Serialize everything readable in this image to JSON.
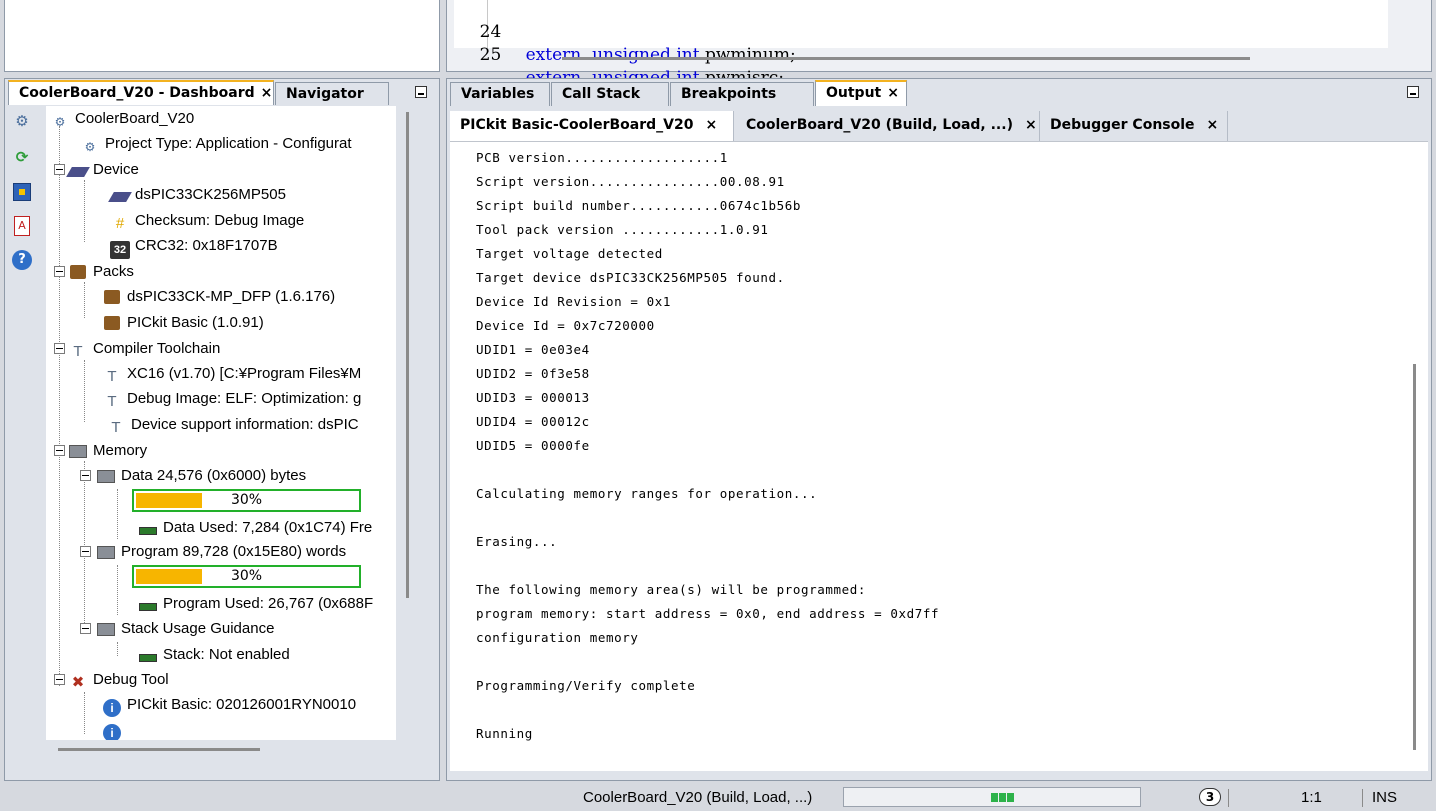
{
  "editor": {
    "lines": [
      {
        "num": "24",
        "kw1": "extern",
        "kw2": "unsigned",
        "kw3": "int",
        "ident": "pwminum;"
      },
      {
        "num": "25",
        "kw1": "extern",
        "kw2": "unsigned",
        "kw3": "int",
        "ident": "pwmisrc;"
      }
    ]
  },
  "dashboard": {
    "tabs": [
      {
        "label": "CoolerBoard_V20 - Dashboard",
        "close": "×"
      },
      {
        "label": "Navigator"
      }
    ],
    "toolbar_icons": [
      "settings-icon",
      "refresh-icon",
      "chip-icon",
      "pdf-icon",
      "help-icon"
    ],
    "tree": {
      "root": "CoolerBoard_V20",
      "project_type": "Project Type: Application - Configurat",
      "device": "Device",
      "device_name": "dsPIC33CK256MP505",
      "checksum": "Checksum: Debug Image",
      "crc": "CRC32: 0x18F1707B",
      "crc_badge": "32",
      "packs": "Packs",
      "pack1": "dsPIC33CK-MP_DFP (1.6.176)",
      "pack2": "PICkit Basic (1.0.91)",
      "compiler": "Compiler Toolchain",
      "xc16": "XC16 (v1.70) [C:¥Program Files¥M",
      "debug_image": "Debug Image: ELF: Optimization: g",
      "device_support": "Device support information: dsPIC",
      "memory": "Memory",
      "data": "Data 24,576 (0x6000) bytes",
      "data_pct_label": "30%",
      "data_pct": 0.3,
      "data_used": "Data Used: 7,284 (0x1C74) Fre",
      "program": "Program 89,728 (0x15E80) words",
      "program_pct_label": "30%",
      "program_pct": 0.3,
      "program_used": "Program Used: 26,767 (0x688F",
      "stack": "Stack Usage Guidance",
      "stack_status": "Stack: Not enabled",
      "debug_tool": "Debug Tool",
      "pickit": "PICkit Basic: 020126001RYN0010"
    }
  },
  "output": {
    "tabs": [
      {
        "label": "Variables"
      },
      {
        "label": "Call Stack"
      },
      {
        "label": "Breakpoints"
      },
      {
        "label": "Output",
        "close": "×"
      }
    ],
    "sub_tabs": [
      {
        "label": "PICkit Basic-CoolerBoard_V20",
        "close": "×"
      },
      {
        "label": "CoolerBoard_V20 (Build, Load, ...)",
        "close": "×"
      },
      {
        "label": "Debugger Console",
        "close": "×"
      }
    ],
    "console_lines": [
      "PCB version...................1",
      "Script version................00.08.91",
      "Script build number...........0674c1b56b",
      "Tool pack version ............1.0.91",
      "Target voltage detected",
      "Target device dsPIC33CK256MP505 found.",
      "Device Id Revision = 0x1",
      "Device Id = 0x7c720000",
      "UDID1 = 0e03e4",
      "UDID2 = 0f3e58",
      "UDID3 = 000013",
      "UDID4 = 00012c",
      "UDID5 = 0000fe",
      "",
      "Calculating memory ranges for operation...",
      "",
      "Erasing...",
      "",
      "The following memory area(s) will be programmed:",
      "program memory: start address = 0x0, end address = 0xd7ff",
      "configuration memory",
      "",
      "Programming/Verify complete",
      "",
      "Running"
    ]
  },
  "statusbar": {
    "task": "CoolerBoard_V20 (Build, Load, ...)",
    "notifications": "3",
    "position": "1:1",
    "mode": "INS"
  }
}
